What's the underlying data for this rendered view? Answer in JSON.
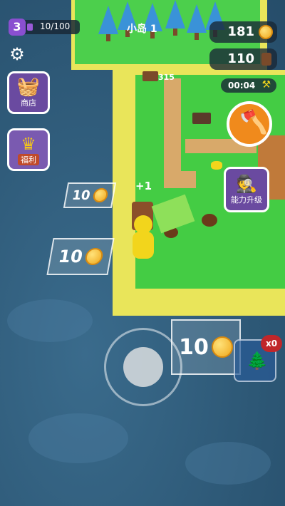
{
  "hud": {
    "level": "3",
    "xp_text": "10/100",
    "island_name": "小岛 1",
    "coins": "181",
    "wood": "110",
    "timer": "00:04"
  },
  "buttons": {
    "shop_label": "商店",
    "welfare_label": "福利",
    "ability_label": "能力升级"
  },
  "plots": {
    "plot1_cost": "10",
    "plot2_cost": "10",
    "plot3_cost": "10"
  },
  "floating": {
    "plus_one": "+1",
    "sign_number": "315"
  },
  "inventory": {
    "multiplier": "x0"
  },
  "xp_progress": 0.1
}
